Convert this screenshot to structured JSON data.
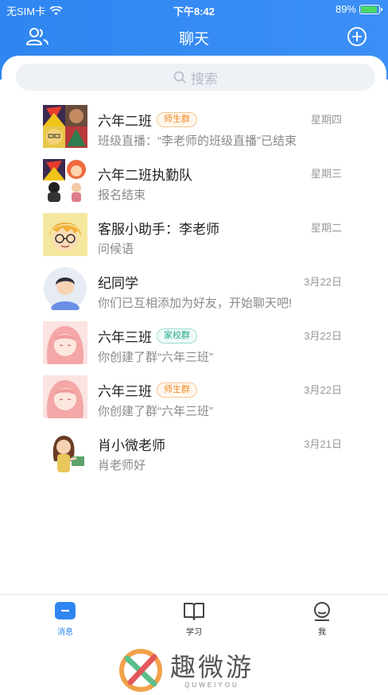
{
  "status_bar": {
    "carrier": "无SIM卡",
    "time": "下午8:42",
    "battery": "89%"
  },
  "nav": {
    "title": "聊天"
  },
  "search": {
    "placeholder": "搜索"
  },
  "chats": [
    {
      "name": "六年二班",
      "tag": "师生群",
      "date": "星期四",
      "preview": "班级直播：“李老师的班级直播”已结束"
    },
    {
      "name": "六年二班执勤队",
      "tag": "",
      "date": "星期三",
      "preview": "报名结束"
    },
    {
      "name": "客服小助手：李老师",
      "tag": "",
      "date": "星期二",
      "preview": "问候语"
    },
    {
      "name": "纪同学",
      "tag": "",
      "date": "3月22日",
      "preview": "你们已互相添加为好友，开始聊天吧!"
    },
    {
      "name": "六年三班",
      "tag": "家校群",
      "date": "3月22日",
      "preview": "你创建了群“六年三班”"
    },
    {
      "name": "六年三班",
      "tag": "师生群",
      "date": "3月22日",
      "preview": "你创建了群“六年三班”"
    },
    {
      "name": "肖小微老师",
      "tag": "",
      "date": "3月21日",
      "preview": "肖老师好"
    }
  ],
  "tabs": {
    "messages": "消息",
    "study": "学习",
    "me": "我"
  },
  "watermark": {
    "title": "趣微游",
    "subtitle": "QUWEIYOU"
  },
  "colors": {
    "brand_blue": "#2f86f0",
    "tag_orange": "#f08a24",
    "tag_green": "#23a98f"
  }
}
